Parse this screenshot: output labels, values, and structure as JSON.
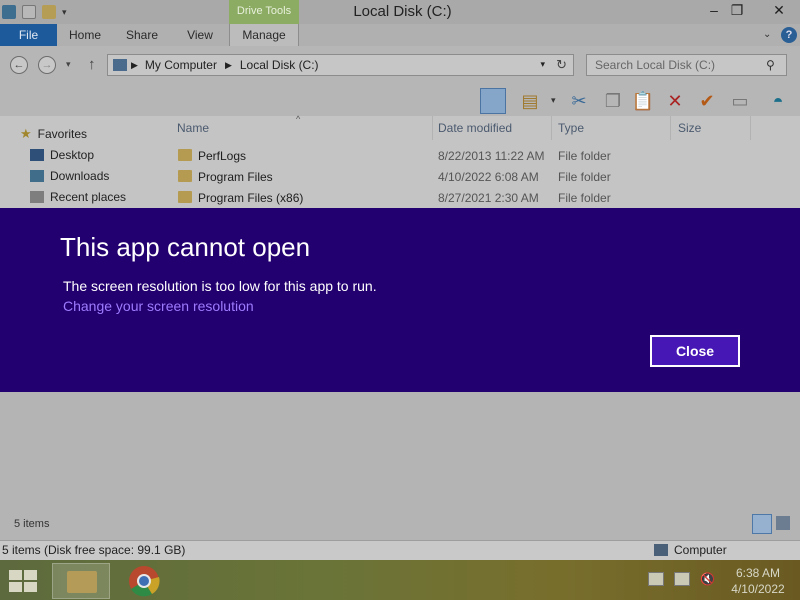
{
  "window": {
    "title": "Local Disk (C:)",
    "contextual_tab": "Drive Tools",
    "tabs": [
      "File",
      "Home",
      "Share",
      "View",
      "Manage"
    ]
  },
  "address": {
    "segments": [
      "My Computer",
      "Local Disk (C:)"
    ],
    "search_placeholder": "Search Local Disk (C:)"
  },
  "navigation": {
    "favorites_label": "Favorites",
    "items": [
      "Desktop",
      "Downloads",
      "Recent places"
    ]
  },
  "columns": [
    "Name",
    "Date modified",
    "Type",
    "Size"
  ],
  "files": [
    {
      "name": "PerfLogs",
      "date": "8/22/2013 11:22 AM",
      "type": "File folder"
    },
    {
      "name": "Program Files",
      "date": "4/10/2022 6:08 AM",
      "type": "File folder"
    },
    {
      "name": "Program Files (x86)",
      "date": "8/27/2021 2:30 AM",
      "type": "File folder"
    }
  ],
  "dialog": {
    "title": "This app cannot open",
    "message": "The screen resolution is too low for this app to run.",
    "link": "Change your screen resolution",
    "close_label": "Close"
  },
  "status": {
    "items_count": "5 items",
    "detail": "5 items (Disk free space: 99.1 GB)",
    "location": "Computer"
  },
  "taskbar": {
    "time": "6:38 AM",
    "date": "4/10/2022"
  },
  "colors": {
    "dialog_bg": "#23006f",
    "dialog_link": "#9d7bff",
    "close_btn_bg": "#4617b5"
  }
}
